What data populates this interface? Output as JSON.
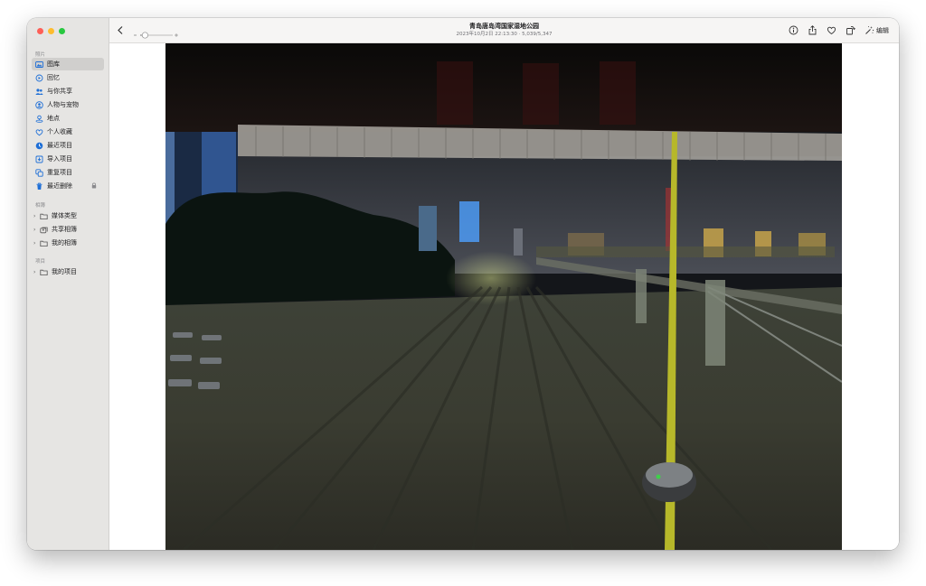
{
  "sidebar": {
    "sections": [
      {
        "heading": "照片",
        "items": [
          {
            "label": "图库",
            "icon": "photo-library-icon",
            "selected": true
          },
          {
            "label": "回忆",
            "icon": "memories-icon"
          },
          {
            "label": "与你共享",
            "icon": "shared-with-you-icon"
          },
          {
            "label": "人物与宠物",
            "icon": "people-pets-icon"
          },
          {
            "label": "地点",
            "icon": "places-icon"
          },
          {
            "label": "个人收藏",
            "icon": "favorites-icon"
          },
          {
            "label": "最近项目",
            "icon": "recents-icon"
          },
          {
            "label": "导入项目",
            "icon": "imports-icon"
          },
          {
            "label": "重复项目",
            "icon": "duplicates-icon"
          },
          {
            "label": "最近删除",
            "icon": "recently-deleted-icon",
            "locked": true
          }
        ]
      },
      {
        "heading": "相簿",
        "items": [
          {
            "label": "媒体类型",
            "icon": "folder-icon",
            "expandable": true
          },
          {
            "label": "共享相簿",
            "icon": "shared-albums-icon",
            "expandable": true
          },
          {
            "label": "我的相簿",
            "icon": "folder-icon",
            "expandable": true
          }
        ]
      },
      {
        "heading": "项目",
        "items": [
          {
            "label": "我的项目",
            "icon": "folder-icon",
            "expandable": true
          }
        ]
      }
    ]
  },
  "toolbar": {
    "title": "青岛唐岛湾国家湿地公园",
    "subtitle": "2023年10月2日 22:13:30 · 5,039/5,347",
    "edit_label": "编辑",
    "zoom_level": 0.15
  },
  "colors": {
    "close": "#fe5f57",
    "minimize": "#febc2e",
    "zoom": "#28c840",
    "accent": "#1f6fd6"
  }
}
